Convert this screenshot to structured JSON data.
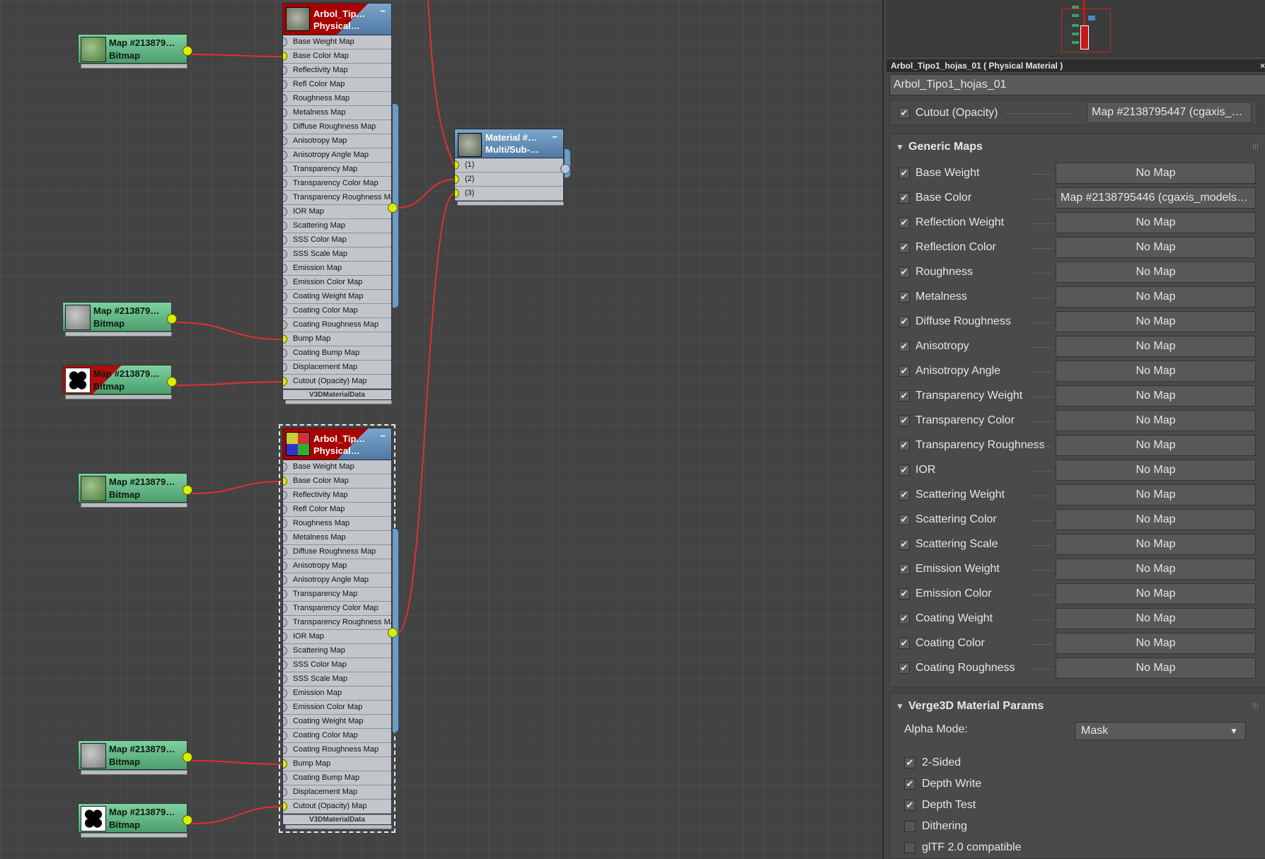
{
  "graph": {
    "bitmap_nodes": [
      {
        "title": "Map  #213879…",
        "subtitle": "Bitmap",
        "thumb": "leaf"
      },
      {
        "title": "Map  #213879…",
        "subtitle": "Bitmap",
        "thumb": "gray"
      },
      {
        "title": "Map  #213879…",
        "subtitle": "Bitmap",
        "thumb": "mask"
      },
      {
        "title": "Map  #213879…",
        "subtitle": "Bitmap",
        "thumb": "leaf"
      },
      {
        "title": "Map  #213879…",
        "subtitle": "Bitmap",
        "thumb": "gray"
      },
      {
        "title": "Map  #213879…",
        "subtitle": "Bitmap",
        "thumb": "mask"
      }
    ],
    "material_nodes": [
      {
        "title": "Arbol_Tip…",
        "subtitle": "Physical…",
        "minimize": "−",
        "footer": "V3DMaterialData"
      },
      {
        "title": "Arbol_Tip…",
        "subtitle": "Physical…",
        "minimize": "−",
        "footer": "V3DMaterialData"
      }
    ],
    "slots": [
      "Base Weight Map",
      "Base Color Map",
      "Reflectivity Map",
      "Refl Color Map",
      "Roughness Map",
      "Metalness Map",
      "Diffuse Roughness Map",
      "Anisotropy Map",
      "Anisotropy Angle Map",
      "Transparency Map",
      "Transparency Color Map",
      "Transparency Roughness Map",
      "IOR Map",
      "Scattering Map",
      "SSS Color Map",
      "SSS Scale Map",
      "Emission Map",
      "Emission Color Map",
      "Coating Weight Map",
      "Coating Color Map",
      "Coating Roughness Map",
      "Bump Map",
      "Coating Bump Map",
      "Displacement Map",
      "Cutout (Opacity) Map"
    ],
    "multi_node": {
      "title": "Material  #…",
      "subtitle": "Multi/Sub-…",
      "minimize": "−",
      "slots": [
        "(1)",
        "(2)",
        "(3)"
      ]
    }
  },
  "panel": {
    "title": "Arbol_Tipo1_hojas_01  ( Physical Material )",
    "close": "×",
    "material_name": "Arbol_Tipo1_hojas_01",
    "cutout": {
      "label": "Cutout (Opacity)",
      "checked": true,
      "map": "Map #2138795447 (cgaxis_…"
    },
    "generic_maps": {
      "heading": "Generic Maps",
      "rows": [
        {
          "label": "Base Weight",
          "map": "No Map"
        },
        {
          "label": "Base Color",
          "map": "Map #2138795446 (cgaxis_models_…"
        },
        {
          "label": "Reflection Weight",
          "map": "No Map"
        },
        {
          "label": "Reflection Color",
          "map": "No Map"
        },
        {
          "label": "Roughness",
          "map": "No Map"
        },
        {
          "label": "Metalness",
          "map": "No Map"
        },
        {
          "label": "Diffuse Roughness",
          "map": "No Map"
        },
        {
          "label": "Anisotropy",
          "map": "No Map"
        },
        {
          "label": "Anisotropy Angle",
          "map": "No Map"
        },
        {
          "label": "Transparency Weight",
          "map": "No Map"
        },
        {
          "label": "Transparency Color",
          "map": "No Map"
        },
        {
          "label": "Transparency Roughness",
          "map": "No Map"
        },
        {
          "label": "IOR",
          "map": "No Map"
        },
        {
          "label": "Scattering Weight",
          "map": "No Map"
        },
        {
          "label": "Scattering Color",
          "map": "No Map"
        },
        {
          "label": "Scattering Scale",
          "map": "No Map"
        },
        {
          "label": "Emission Weight",
          "map": "No Map"
        },
        {
          "label": "Emission Color",
          "map": "No Map"
        },
        {
          "label": "Coating Weight",
          "map": "No Map"
        },
        {
          "label": "Coating Color",
          "map": "No Map"
        },
        {
          "label": "Coating Roughness",
          "map": "No Map"
        }
      ]
    },
    "verge3d": {
      "heading": "Verge3D Material Params",
      "alpha_mode_label": "Alpha Mode:",
      "alpha_mode_value": "Mask",
      "options": [
        {
          "label": "2-Sided",
          "checked": true
        },
        {
          "label": "Depth Write",
          "checked": true
        },
        {
          "label": "Depth Test",
          "checked": true
        },
        {
          "label": "Dithering",
          "checked": false
        },
        {
          "label": "glTF 2.0 compatible",
          "checked": false
        }
      ]
    },
    "check_glyph": "✔"
  },
  "colors": {
    "wire": "#e03030",
    "port_active": "#d8f000",
    "bitmap_node": "#6cbf8c",
    "material_node": "#6a93bb",
    "canvas_bg": "#434343",
    "panel_bg": "#444444"
  }
}
